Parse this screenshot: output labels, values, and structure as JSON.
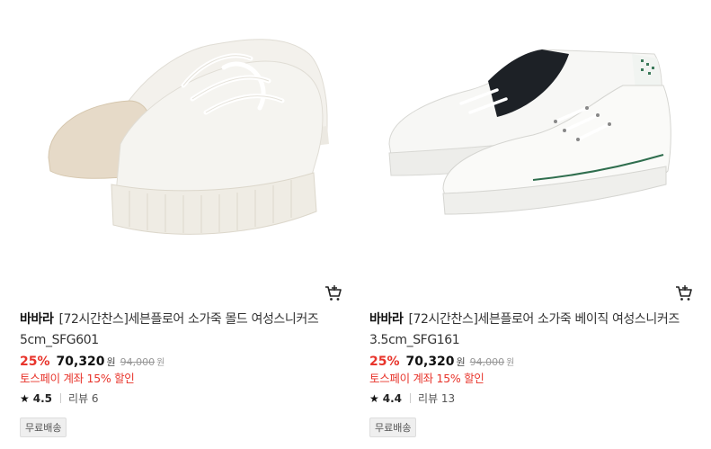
{
  "products": [
    {
      "brand": "바바라",
      "name": "[72시간찬스]세븐플로어 소가죽 몰드 여성스니커즈 5cm_SFG601",
      "discount": "25%",
      "price": "70,320",
      "price_unit": "원",
      "original_price": "94,000",
      "original_unit": "원",
      "promo": "토스페이 계좌 15% 할인",
      "rating": "4.5",
      "reviews": "리뷰 6",
      "badge": "무료배송",
      "image_icon": "beige-platform-sneakers-image",
      "cart_icon": "cart-icon"
    },
    {
      "brand": "바바라",
      "name": "[72시간찬스]세븐플로어 소가죽 베이직 여성스니커즈 3.5cm_SFG161",
      "discount": "25%",
      "price": "70,320",
      "price_unit": "원",
      "original_price": "94,000",
      "original_unit": "원",
      "promo": "토스페이 계좌 15% 할인",
      "rating": "4.4",
      "reviews": "리뷰 13",
      "badge": "무료배송",
      "image_icon": "white-black-sneakers-image",
      "cart_icon": "cart-icon"
    }
  ],
  "colors": {
    "discount": "#e8342b",
    "promo": "#e8342b",
    "badge_bg": "#efefef"
  }
}
